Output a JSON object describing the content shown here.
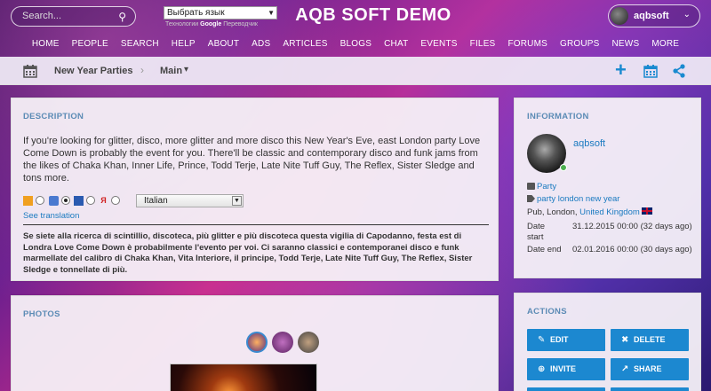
{
  "header": {
    "search_placeholder": "Search...",
    "language_select": "Выбрать язык",
    "google_credit_prefix": "Технологии",
    "google_credit_brand": "Google",
    "google_credit_suffix": "Переводчик",
    "site_title": "AQB SOFT DEMO",
    "user_name": "aqbsoft"
  },
  "nav": [
    "HOME",
    "PEOPLE",
    "SEARCH",
    "HELP",
    "ABOUT",
    "ADS",
    "ARTICLES",
    "BLOGS",
    "CHAT",
    "EVENTS",
    "FILES",
    "FORUMS",
    "GROUPS",
    "NEWS",
    "MORE"
  ],
  "breadcrumb": {
    "item1": "New Year Parties",
    "item2": "Main"
  },
  "description": {
    "title": "DESCRIPTION",
    "text": "If you're looking for glitter, disco, more glitter and more disco this New Year's Eve, east London party Love Come Down is probably the event for you. There'll be classic and contemporary disco and funk jams from the likes of Chaka Khan, Inner Life, Prince, Todd Terje, Late Nite Tuff Guy, The Reflex, Sister Sledge and tons more.",
    "translate_language": "Italian",
    "see_translation": "See translation",
    "translated_text": "Se siete alla ricerca di scintillio, discoteca, più glitter e più discoteca questa vigilia di Capodanno, festa est di Londra Love Come Down è probabilmente l'evento per voi. Ci saranno classici e contemporanei disco e funk marmellate del calibro di Chaka Khan, Vita Interiore, il principe, Todd Terje, Late Nite Tuff Guy, The Reflex, Sister Sledge e tonnellate di più."
  },
  "photos": {
    "title": "PHOTOS"
  },
  "information": {
    "title": "INFORMATION",
    "user": "aqbsoft",
    "category": "Party",
    "tags": "party london new year",
    "location_prefix": "Pub, London,",
    "country": "United Kingdom",
    "date_start_label": "Date start",
    "date_start_value": "31.12.2015 00:00 (32 days ago)",
    "date_end_label": "Date end",
    "date_end_value": "02.01.2016 00:00 (30 days ago)"
  },
  "actions": {
    "title": "ACTIONS",
    "edit": "EDIT",
    "delete": "DELETE",
    "invite": "INVITE",
    "share": "SHARE"
  },
  "colors": {
    "accent": "#1c88d0",
    "panel_title": "#5b8bb5",
    "link": "#1a7ac0",
    "online": "#4caf50"
  }
}
